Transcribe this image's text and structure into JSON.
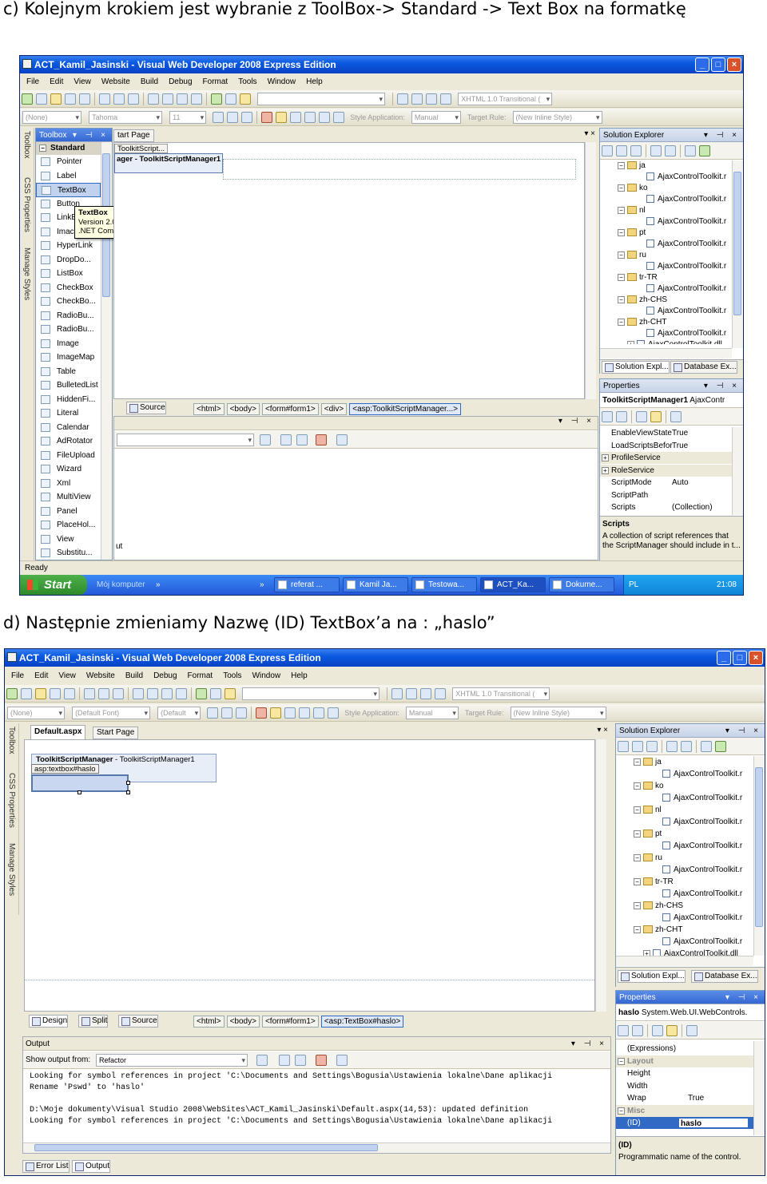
{
  "captions": {
    "c": "c)    Kolejnym krokiem jest wybranie z ToolBox-> Standard -> Text Box na formatkę",
    "d": "d) Następnie zmieniamy Nazwę (ID) TextBox’a na : „haslo”"
  },
  "app": {
    "title": "ACT_Kamil_Jasinski - Visual Web Developer 2008 Express Edition",
    "menu": [
      "File",
      "Edit",
      "View",
      "Website",
      "Build",
      "Debug",
      "Format",
      "Tools",
      "Window",
      "Help"
    ],
    "doctype": "XHTML 1.0 Transitional (",
    "style_application_label": "Style Application:",
    "style_application_value": "Manual",
    "target_rule_label": "Target Rule:",
    "target_rule_value": "(New Inline Style)",
    "side_tabs": [
      "Toolbox",
      "CSS Properties",
      "Manage Styles"
    ]
  },
  "shot1": {
    "font_box": "(None)",
    "font_name": "Tahoma",
    "font_size": "11",
    "toolbox_title": "Toolbox",
    "toolbox_section": "Standard",
    "toolbox_items": [
      "Pointer",
      "Label",
      "TextBox",
      "Button",
      "LinkE",
      "Imac",
      "HyperLink",
      "DropDo...",
      "ListBox",
      "CheckBox",
      "CheckBo...",
      "RadioBu...",
      "RadioBu...",
      "Image",
      "ImageMap",
      "Table",
      "BulletedList",
      "HiddenFi...",
      "Literal",
      "Calendar",
      "AdRotator",
      "FileUpload",
      "Wizard",
      "Xml",
      "MultiView",
      "Panel",
      "PlaceHol...",
      "View",
      "Substitu..."
    ],
    "tooltip": [
      "TextBox",
      "Version 2.0.0.0 from Microsoft Corporation",
      ".NET Component"
    ],
    "doc_tabs": [
      "tart Page"
    ],
    "design_tag": "ToolkitScript...",
    "design_header": "ager - ToolkitScriptManager1",
    "source_tab": "Source",
    "breadcrumbs": [
      "<html>",
      "<body>",
      "<form#form1>",
      "<div>",
      "<asp:ToolkitScriptManager...>"
    ],
    "output_snip": "ut",
    "status": "Ready",
    "solution_explorer": "Solution Explorer",
    "tree": [
      {
        "folder": "ja",
        "file": "AjaxControlToolkit.r"
      },
      {
        "folder": "ko",
        "file": "AjaxControlToolkit.r"
      },
      {
        "folder": "nl",
        "file": "AjaxControlToolkit.r"
      },
      {
        "folder": "pt",
        "file": "AjaxControlToolkit.r"
      },
      {
        "folder": "ru",
        "file": "AjaxControlToolkit.r"
      },
      {
        "folder": "tr-TR",
        "file": "AjaxControlToolkit.r"
      },
      {
        "folder": "zh-CHS",
        "file": "AjaxControlToolkit.r"
      },
      {
        "folder": "zh-CHT",
        "file": "AjaxControlToolkit.r"
      }
    ],
    "tree_last": "AjaxControlToolkit.dll",
    "panel_tabs": [
      "Solution Expl...",
      "Database Ex..."
    ],
    "properties_title": "Properties",
    "prop_object_name": "ToolkitScriptManager1",
    "prop_object_type": "AjaxContr",
    "properties": [
      {
        "key": "EnableViewState",
        "value": "True",
        "group": false
      },
      {
        "key": "LoadScriptsBefor",
        "value": "True",
        "group": false
      },
      {
        "key": "ProfileService",
        "value": "",
        "group": true
      },
      {
        "key": "RoleService",
        "value": "",
        "group": true
      },
      {
        "key": "ScriptMode",
        "value": "Auto",
        "group": false
      },
      {
        "key": "ScriptPath",
        "value": "",
        "group": false
      },
      {
        "key": "Scripts",
        "value": "(Collection)",
        "group": false
      }
    ],
    "desc_title": "Scripts",
    "desc_text": [
      "A collection of script references that",
      "the ScriptManager should include in t..."
    ],
    "taskbar": {
      "start": "Start",
      "my_computer": "Mój komputer",
      "items": [
        "referat ...",
        "Kamil Ja...",
        "Testowa...",
        "ACT_Ka...",
        "Dokume..."
      ],
      "lang": "PL",
      "clock": "21:08"
    }
  },
  "shot2": {
    "font_box": "(None)",
    "font_name": "(Default Font)",
    "font_size": "(Default",
    "doc_tabs": [
      "Default.aspx",
      "Start Page"
    ],
    "design_header_bold": "ToolkitScriptManager",
    "design_header_rest": " - ToolkitScriptManager1",
    "textbox_tag": "asp:textbox#haslo",
    "view_tabs": [
      "Design",
      "Split",
      "Source"
    ],
    "breadcrumbs": [
      "<html>",
      "<body>",
      "<form#form1>",
      "<asp:TextBox#haslo>"
    ],
    "output_title": "Output",
    "show_output_label": "Show output from:",
    "show_output_value": "Refactor",
    "output_lines": [
      "Looking for symbol references in project 'C:\\Documents and Settings\\Bogusia\\Ustawienia lokalne\\Dane aplikacji",
      "Rename 'Pswd' to 'haslo'",
      "",
      "D:\\Moje dokumenty\\Visual Studio 2008\\WebSites\\ACT_Kamil_Jasinski\\Default.aspx(14,53): updated definition",
      "Looking for symbol references in project 'C:\\Documents and Settings\\Bogusia\\Ustawienia lokalne\\Dane aplikacji"
    ],
    "bottom_tabs": [
      "Error List",
      "Output"
    ],
    "solution_explorer": "Solution Explorer",
    "tree": [
      {
        "folder": "ja",
        "file": "AjaxControlToolkit.r"
      },
      {
        "folder": "ko",
        "file": "AjaxControlToolkit.r"
      },
      {
        "folder": "nl",
        "file": "AjaxControlToolkit.r"
      },
      {
        "folder": "pt",
        "file": "AjaxControlToolkit.r"
      },
      {
        "folder": "ru",
        "file": "AjaxControlToolkit.r"
      },
      {
        "folder": "tr-TR",
        "file": "AjaxControlToolkit.r"
      },
      {
        "folder": "zh-CHS",
        "file": "AjaxControlToolkit.r"
      },
      {
        "folder": "zh-CHT",
        "file": "AjaxControlToolkit.r"
      }
    ],
    "tree_last": "AjaxControlToolkit.dll",
    "panel_tabs": [
      "Solution Expl...",
      "Database Ex..."
    ],
    "properties_title": "Properties",
    "prop_object_name": "haslo",
    "prop_object_type": "System.Web.UI.WebControls.",
    "properties": [
      {
        "key": "(Expressions)",
        "value": "",
        "group": false
      },
      {
        "key": "Layout",
        "value": "",
        "group": true
      },
      {
        "key": "Height",
        "value": "",
        "group": false
      },
      {
        "key": "Width",
        "value": "",
        "group": false
      },
      {
        "key": "Wrap",
        "value": "True",
        "group": false
      },
      {
        "key": "Misc",
        "value": "",
        "group": true
      },
      {
        "key": "(ID)",
        "value": "haslo",
        "group": false
      }
    ],
    "desc_title": "(ID)",
    "desc_text": "Programmatic name of the control."
  },
  "colors": {
    "title_blue": "#0a5ae0",
    "selection": "#316ac5",
    "chrome": "#ece9d8",
    "taskbar_blue": "#2458d8",
    "start_green": "#2e8a2a"
  }
}
